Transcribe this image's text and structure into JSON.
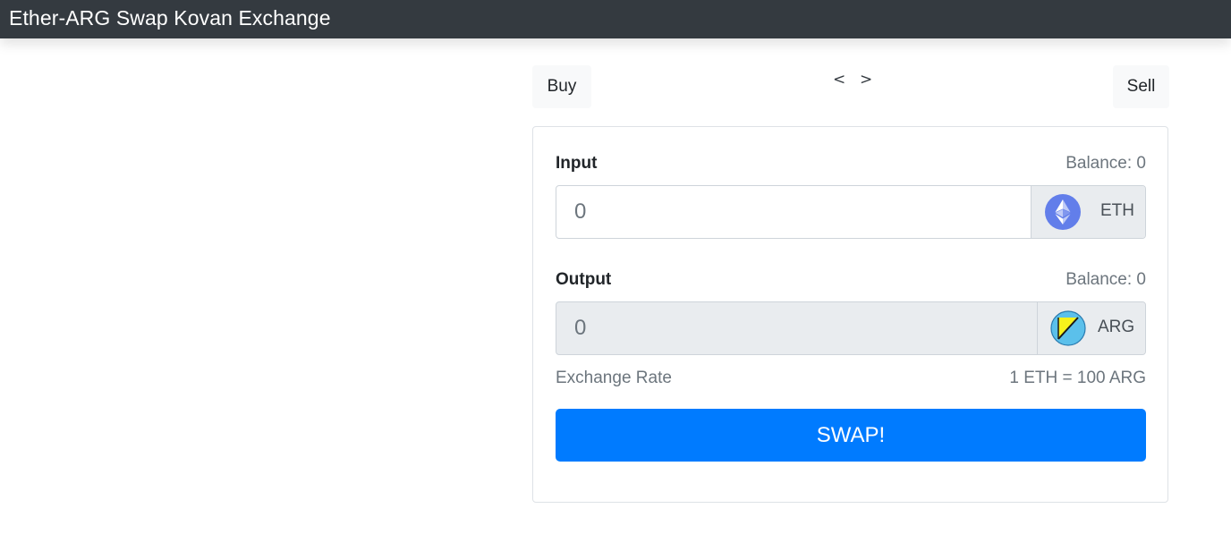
{
  "navbar": {
    "brand": "Ether-ARG Swap Kovan Exchange"
  },
  "mode_tabs": {
    "buy_label": "Buy",
    "sell_label": "Sell",
    "prev_label": "<",
    "next_label": ">"
  },
  "input_section": {
    "label": "Input",
    "balance": "Balance: 0",
    "placeholder": "0",
    "token": {
      "symbol": "ETH",
      "icon": "ethereum-icon"
    }
  },
  "output_section": {
    "label": "Output",
    "balance": "Balance: 0",
    "placeholder": "0",
    "token": {
      "symbol": "ARG",
      "icon": "arg-token-icon"
    }
  },
  "exchange_rate": {
    "label": "Exchange Rate",
    "value": "1 ETH = 100 ARG"
  },
  "swap_button": {
    "label": "SWAP!"
  },
  "colors": {
    "navbar": "#343a40",
    "primary": "#007bff",
    "addon_bg": "#e9ecef",
    "muted_text": "#6c757d"
  }
}
